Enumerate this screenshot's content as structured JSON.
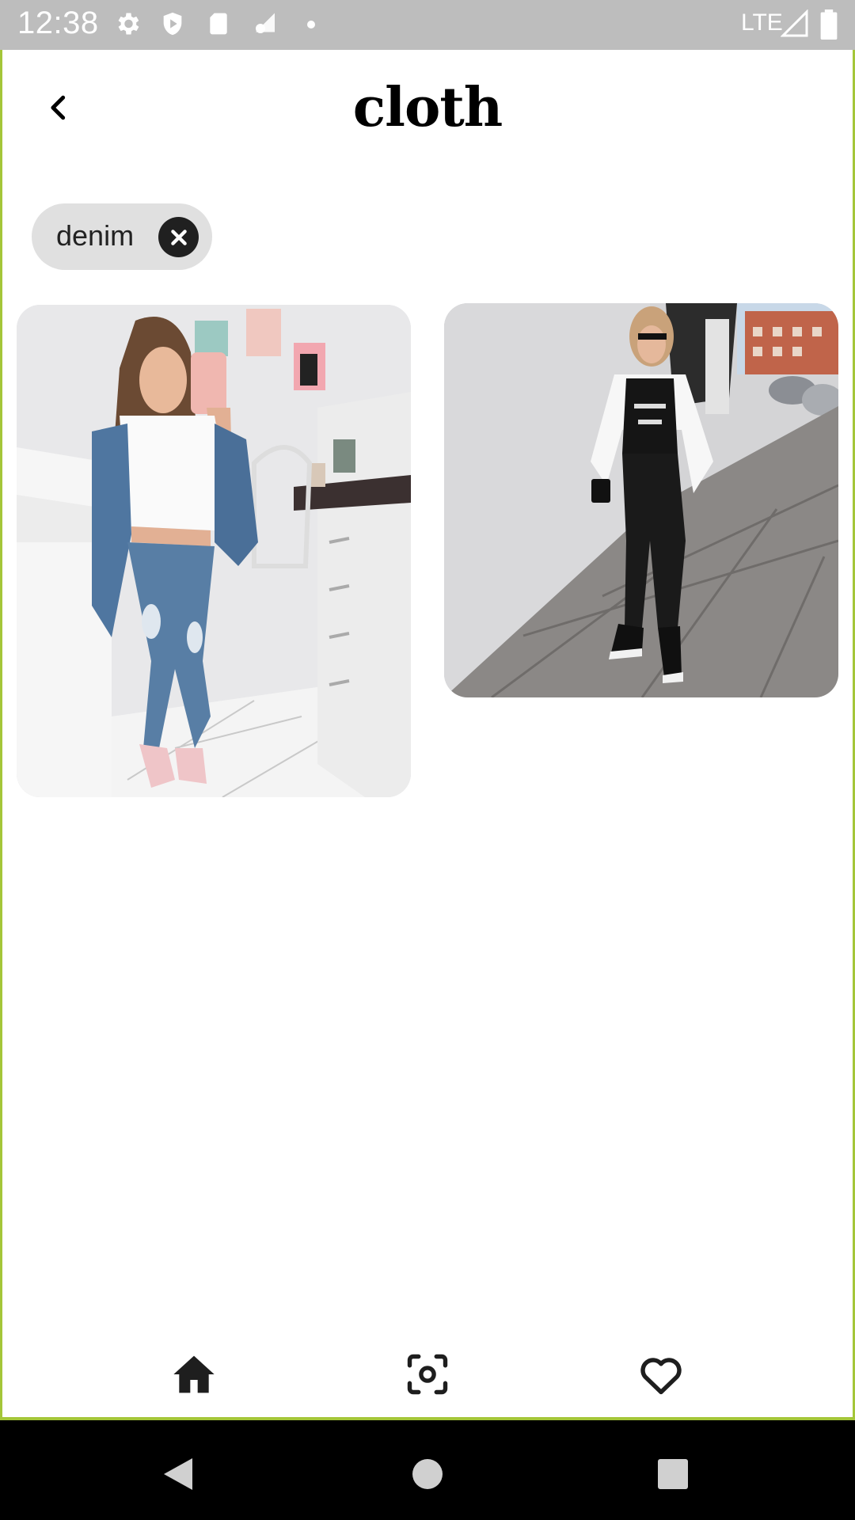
{
  "status_bar": {
    "time": "12:38",
    "network": "LTE",
    "icons": [
      "gear-icon",
      "shield-icon",
      "sd-card-icon",
      "sync-icon",
      "dot-icon",
      "signal-icon",
      "battery-icon"
    ]
  },
  "header": {
    "title": "cloth",
    "back_icon": "chevron-left-icon"
  },
  "filter_chip": {
    "label": "denim",
    "remove_icon": "close-circle-icon"
  },
  "results": [
    {
      "image": "woman mirror selfie in white crop top, denim jacket and ripped jeans"
    },
    {
      "image": "woman in white blazer, black tee and black leather joggers on sidewalk"
    }
  ],
  "bottom_nav": {
    "items": [
      {
        "icon": "home-icon"
      },
      {
        "icon": "scan-icon"
      },
      {
        "icon": "heart-icon"
      }
    ]
  },
  "system_nav": {
    "icons": [
      "triangle-back-icon",
      "circle-home-icon",
      "square-recents-icon"
    ]
  },
  "colors": {
    "status_bar_bg": "#bdbdbd",
    "frame_border": "#a4c639",
    "chip_bg": "#e0e0e0",
    "chip_close_bg": "#202020",
    "text": "#000000"
  }
}
